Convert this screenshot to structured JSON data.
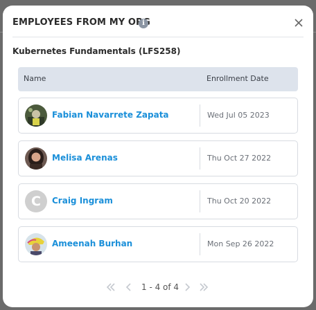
{
  "modal": {
    "title": "EMPLOYEES FROM MY ORG",
    "course": "Kubernetes Fundamentals (LFS258)"
  },
  "table": {
    "headers": {
      "name": "Name",
      "date": "Enrollment Date"
    },
    "rows": [
      {
        "name": "Fabian Navarrete Zapata",
        "date": "Wed Jul 05 2023",
        "avatar": "photo"
      },
      {
        "name": "Melisa Arenas",
        "date": "Thu Oct 27 2022",
        "avatar": "photo"
      },
      {
        "name": "Craig Ingram",
        "date": "Thu Oct 20 2022",
        "avatar": "initial",
        "initial": "C"
      },
      {
        "name": "Ameenah Burhan",
        "date": "Mon Sep 26 2022",
        "avatar": "photo"
      }
    ]
  },
  "pagination": {
    "label": "1 - 4 of 4"
  },
  "icons": {
    "info": "info-icon",
    "close": "close-icon",
    "first": "double-chevron-left-icon",
    "prev": "chevron-left-icon",
    "next": "chevron-right-icon",
    "last": "double-chevron-right-icon"
  },
  "colors": {
    "accent": "#1a8fd9",
    "header_bg": "#dde3ec"
  }
}
